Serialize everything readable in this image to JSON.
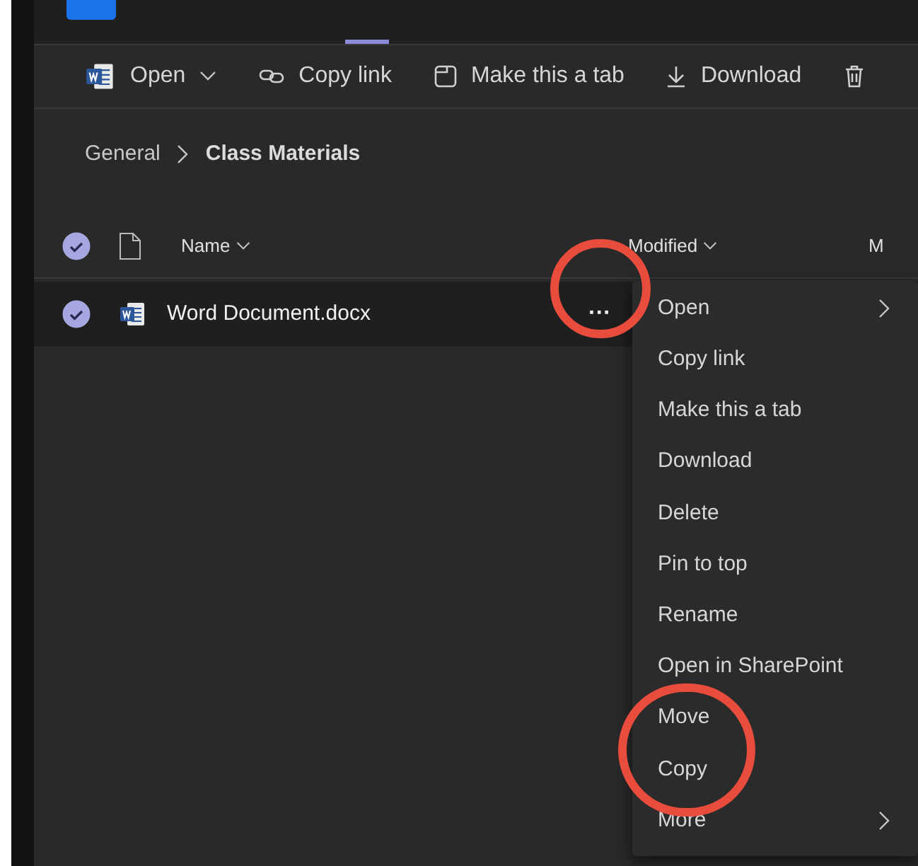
{
  "toolbar": [
    {
      "kind": "word",
      "label": "Open",
      "dropdown": true
    },
    {
      "kind": "link",
      "label": "Copy link",
      "dropdown": false
    },
    {
      "kind": "tab",
      "label": "Make this a tab",
      "dropdown": false
    },
    {
      "kind": "download",
      "label": "Download",
      "dropdown": false
    },
    {
      "kind": "delete",
      "dropdown": false
    }
  ],
  "breadcrumb": [
    "General",
    "Class Materials"
  ],
  "table": {
    "select_all_checked": true,
    "columns": [
      {
        "label": "Name",
        "sortable": true
      },
      {
        "label": "Modified",
        "sortable": true
      },
      {
        "label": "M",
        "sortable": false
      }
    ],
    "rows": [
      {
        "name": "Word Document.docx",
        "checked": true,
        "more": "···"
      }
    ]
  },
  "context_menu": [
    {
      "kind": "submenu",
      "label": "Open"
    },
    {
      "kind": "action",
      "label": "Copy link"
    },
    {
      "kind": "action",
      "label": "Make this a tab"
    },
    {
      "kind": "action",
      "label": "Download"
    },
    {
      "kind": "action",
      "label": "Delete"
    },
    {
      "kind": "action",
      "label": "Pin to top"
    },
    {
      "kind": "action",
      "label": "Rename"
    },
    {
      "kind": "action",
      "label": "Open in SharePoint"
    },
    {
      "kind": "action",
      "label": "Move"
    },
    {
      "kind": "action",
      "label": "Copy"
    },
    {
      "kind": "submenu",
      "label": "More"
    }
  ]
}
